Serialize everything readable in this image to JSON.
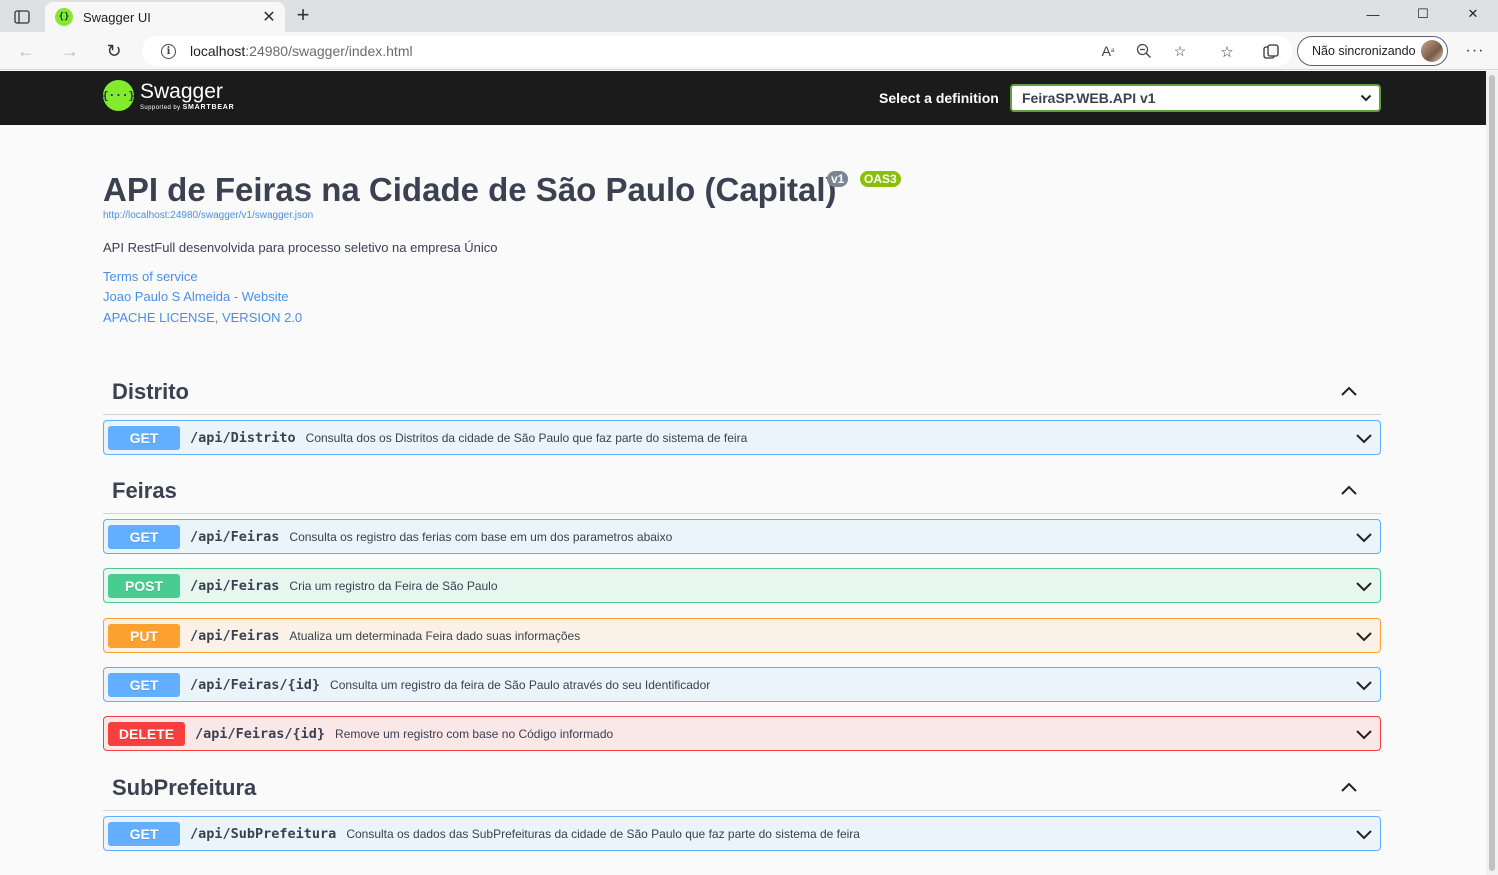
{
  "browser": {
    "tab_title": "Swagger UI",
    "url_host": "localhost",
    "url_rest": ":24980/swagger/index.html",
    "sync_label": "Não sincronizando"
  },
  "topbar": {
    "logo_word": "Swagger",
    "logo_sub_prefix": "Supported by",
    "logo_sub_brand": "SMARTBEAR",
    "definition_label": "Select a definition",
    "definition_value": "FeiraSP.WEB.API v1"
  },
  "info": {
    "title": "API de Feiras na Cidade de São Paulo (Capital)",
    "version_badge": "v1",
    "oas_badge": "OAS3",
    "spec_url": "http://localhost:24980/swagger/v1/swagger.json",
    "description": "API RestFull desenvolvida para processo seletivo na empresa Único",
    "links": [
      "Terms of service",
      "Joao Paulo S Almeida - Website",
      "APACHE LICENSE, VERSION 2.0"
    ]
  },
  "tags": [
    {
      "name": "Distrito",
      "operations": [
        {
          "method": "GET",
          "path": "/api/Distrito",
          "summary": "Consulta dos os Distritos da cidade de São Paulo que faz parte do sistema de feira"
        }
      ]
    },
    {
      "name": "Feiras",
      "operations": [
        {
          "method": "GET",
          "path": "/api/Feiras",
          "summary": "Consulta os registro das ferias com base em um dos parametros abaixo"
        },
        {
          "method": "POST",
          "path": "/api/Feiras",
          "summary": "Cria um registro da Feira de São Paulo"
        },
        {
          "method": "PUT",
          "path": "/api/Feiras",
          "summary": "Atualiza um determinada Feira dado suas informações"
        },
        {
          "method": "GET",
          "path": "/api/Feiras/{id}",
          "summary": "Consulta um registro da feira de São Paulo através do seu Identificador"
        },
        {
          "method": "DELETE",
          "path": "/api/Feiras/{id}",
          "summary": "Remove um registro com base no Código informado"
        }
      ]
    },
    {
      "name": "SubPrefeitura",
      "operations": [
        {
          "method": "GET",
          "path": "/api/SubPrefeitura",
          "summary": "Consulta os dados das SubPrefeituras da cidade de São Paulo que faz parte do sistema de feira"
        }
      ]
    }
  ],
  "colors": {
    "get": "#61affe",
    "post": "#49cc90",
    "put": "#fca130",
    "delete": "#f93e3e",
    "swagger_green": "#85ea2d",
    "topbar": "#1b1b1b"
  }
}
